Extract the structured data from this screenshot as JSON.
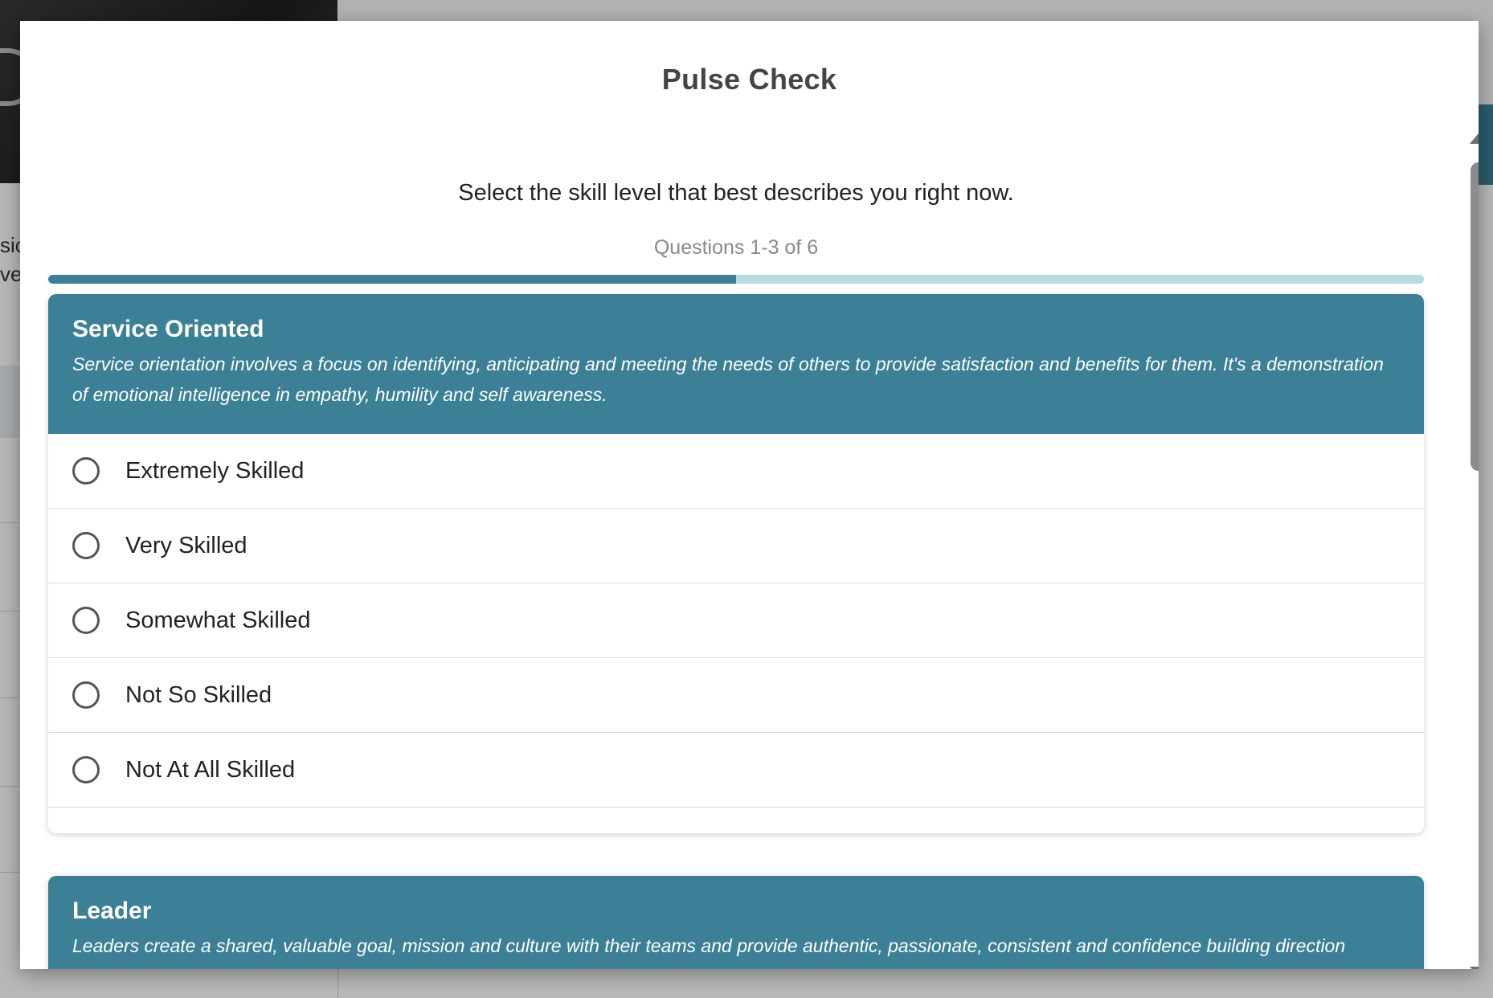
{
  "background": {
    "fragment_1": "sic",
    "fragment_2": "ve"
  },
  "modal": {
    "title": "Pulse Check",
    "instructions": "Select the skill level that best describes you right now.",
    "progress_label": "Questions 1-3 of 6",
    "progress_fraction": 0.5
  },
  "questions": [
    {
      "title": "Service Oriented",
      "description": "Service orientation involves a focus on identifying, anticipating and meeting the needs of others to provide satisfaction and benefits for them. It's a demonstration of emotional intelligence in empathy, humility and self awareness.",
      "options": [
        "Extremely Skilled",
        "Very Skilled",
        "Somewhat Skilled",
        "Not So Skilled",
        "Not At All Skilled"
      ],
      "selected": null
    },
    {
      "title": "Leader",
      "description": "Leaders create a shared, valuable goal, mission and culture with their teams and provide authentic, passionate, consistent and confidence building direction"
    }
  ],
  "colors": {
    "accent": "#3b8096",
    "progress_track": "#b8dbe0"
  }
}
